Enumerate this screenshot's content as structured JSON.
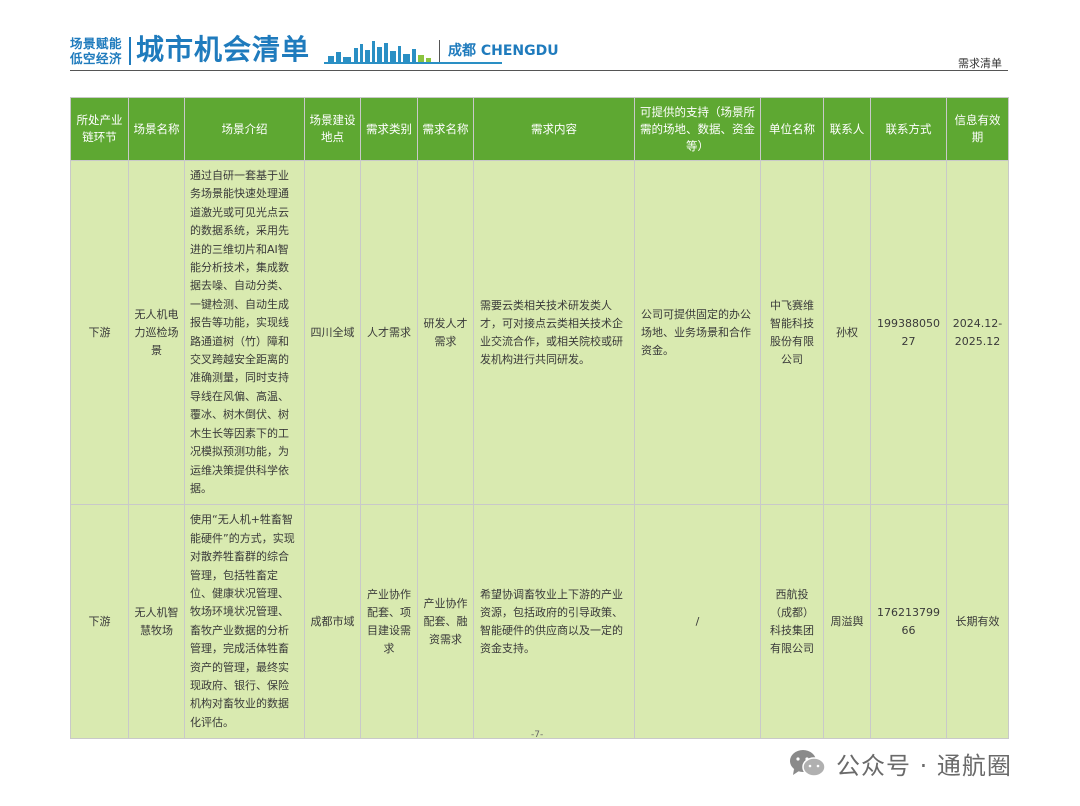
{
  "header": {
    "tag_line1": "场景赋能",
    "tag_line2": "低空经济",
    "title": "城市机会清单",
    "city": "成都 CHENGDU",
    "section_label": "需求清单"
  },
  "table": {
    "columns": [
      "所处产业链环节",
      "场景名称",
      "场景介绍",
      "场景建设地点",
      "需求类别",
      "需求名称",
      "需求内容",
      "可提供的支持（场景所需的场地、数据、资金等）",
      "单位名称",
      "联系人",
      "联系方式",
      "信息有效期"
    ],
    "rows": [
      {
        "chain": "下游",
        "name": "无人机电力巡检场景",
        "intro": "通过自研一套基于业务场景能快速处理通道激光或可见光点云的数据系统，采用先进的三维切片和AI智能分析技术，集成数据去噪、自动分类、一键检测、自动生成报告等功能，实现线路通道树（竹）障和交叉跨越安全距离的准确测量，同时支持导线在风偏、高温、覆冰、树木倒伏、树木生长等因素下的工况模拟预测功能，为运维决策提供科学依据。",
        "location": "四川全域",
        "category": "人才需求",
        "demand_name": "研发人才需求",
        "demand": "需要云类相关技术研发类人才，可对接点云类相关技术企业交流合作，或相关院校或研发机构进行共同研发。",
        "support": "公司可提供固定的办公场地、业务场景和合作资金。",
        "company": "中飞赛维智能科技股份有限公司",
        "contact": "孙权",
        "phone": "19938805027",
        "validity": "2024.12-2025.12"
      },
      {
        "chain": "下游",
        "name": "无人机智慧牧场",
        "intro": "使用“无人机+牲畜智能硬件”的方式，实现对散养牲畜群的综合管理，包括牲畜定位、健康状况管理、牧场环境状况管理、畜牧产业数据的分析管理，完成活体牲畜资产的管理，最终实现政府、银行、保险机构对畜牧业的数据化评估。",
        "location": "成都市域",
        "category": "产业协作配套、项目建设需求",
        "demand_name": "产业协作配套、融资需求",
        "demand": "希望协调畜牧业上下游的产业资源，包括政府的引导政策、智能硬件的供应商以及一定的资金支持。",
        "support": "/",
        "company": "西航投（成都）科技集团有限公司",
        "contact": "周溢舆",
        "phone": "17621379966",
        "validity": "长期有效"
      }
    ]
  },
  "page_number": "-7-",
  "watermark": "公众号 · 通航圈",
  "colors": {
    "header_green": "#5ea832",
    "cell_green": "#d9eab0",
    "brand_blue": "#1f7bbd"
  }
}
